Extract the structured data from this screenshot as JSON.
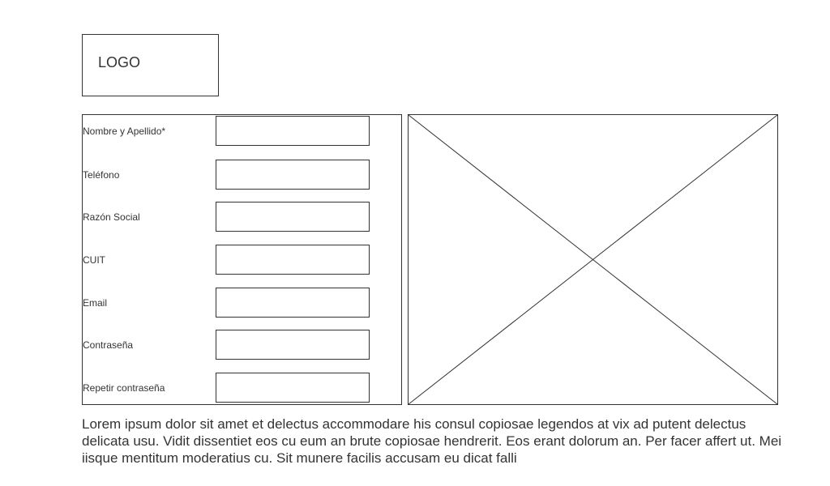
{
  "header": {
    "logo_text": "LOGO"
  },
  "form": {
    "fields": [
      {
        "label": "Nombre y Apellido*",
        "value": ""
      },
      {
        "label": "Teléfono",
        "value": ""
      },
      {
        "label": "Razón Social",
        "value": ""
      },
      {
        "label": "CUIT",
        "value": ""
      },
      {
        "label": "Email",
        "value": ""
      },
      {
        "label": "Contraseña",
        "value": ""
      },
      {
        "label": "Repetir contraseña",
        "value": ""
      }
    ]
  },
  "main": {
    "image_placeholder": "image-placeholder-icon",
    "paragraph": "Lorem ipsum dolor sit amet et delectus accommodare his consul copiosae legendos at vix ad putent delectus delicata usu. Vidit dissentiet eos cu eum an brute copiosae hendrerit. Eos erant dolorum an. Per facer affert ut. Mei iisque mentitum moderatius cu. Sit munere facilis accusam eu dicat falli"
  },
  "colors": {
    "stroke": "#333333",
    "background": "#ffffff"
  }
}
